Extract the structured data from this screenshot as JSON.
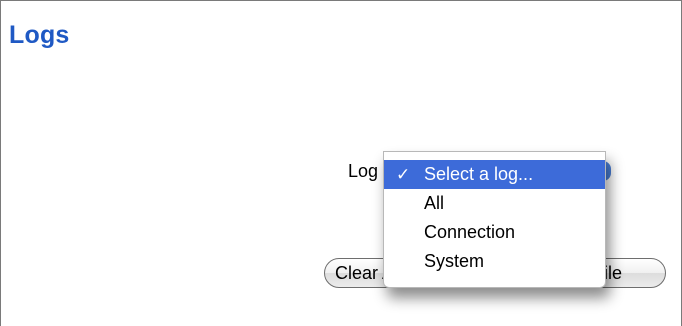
{
  "page": {
    "title": "Logs"
  },
  "log_selector": {
    "label": "Log",
    "menu": [
      {
        "label": "Select a log...",
        "selected": true,
        "check": "✓"
      },
      {
        "label": "All",
        "selected": false
      },
      {
        "label": "Connection",
        "selected": false
      },
      {
        "label": "System",
        "selected": false
      }
    ]
  },
  "buttons": {
    "clear_label": "Clear All Logs",
    "save_label": "Save to File"
  },
  "colors": {
    "title": "#1f59c4",
    "selection": "#3d6bd9"
  }
}
